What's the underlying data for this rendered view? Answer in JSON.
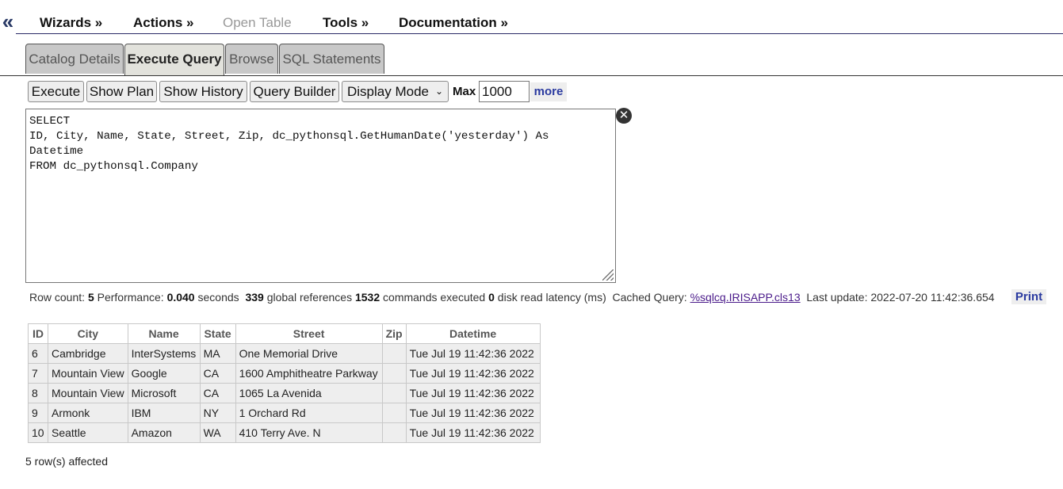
{
  "menu": {
    "collapse_glyph": "«",
    "items": [
      {
        "label": "Wizards »",
        "enabled": true
      },
      {
        "label": "Actions »",
        "enabled": true
      },
      {
        "label": "Open Table",
        "enabled": false
      },
      {
        "label": "Tools »",
        "enabled": true
      },
      {
        "label": "Documentation »",
        "enabled": true
      }
    ]
  },
  "tabs": [
    {
      "label": "Catalog Details",
      "active": false
    },
    {
      "label": "Execute Query",
      "active": true
    },
    {
      "label": "Browse",
      "active": false
    },
    {
      "label": "SQL Statements",
      "active": false
    }
  ],
  "toolbar": {
    "execute_label": "Execute",
    "show_plan_label": "Show Plan",
    "show_history_label": "Show History",
    "query_builder_label": "Query Builder",
    "display_mode_value": "Display Mode",
    "max_label": "Max",
    "max_value": "1000",
    "more_label": "more"
  },
  "query": {
    "text": "SELECT\nID, City, Name, State, Street, Zip, dc_pythonsql.GetHumanDate('yesterday') As\nDatetime\nFROM dc_pythonsql.Company"
  },
  "stats": {
    "row_count_label": "Row count:",
    "row_count": "5",
    "performance_label": "Performance:",
    "performance": "0.040",
    "seconds_label": "seconds",
    "global_refs": "339",
    "global_refs_label": "global references",
    "commands": "1532",
    "commands_label": "commands executed",
    "disk_latency": "0",
    "disk_latency_label": "disk read latency (ms)",
    "cached_query_label": "Cached Query:",
    "cached_query": "%sqlcq.IRISAPP.cls13",
    "last_update_label": "Last update:",
    "last_update": "2022-07-20 11:42:36.654",
    "print_label": "Print"
  },
  "results": {
    "columns": [
      "ID",
      "City",
      "Name",
      "State",
      "Street",
      "Zip",
      "Datetime"
    ],
    "rows": [
      [
        "6",
        "Cambridge",
        "InterSystems",
        "MA",
        "One Memorial Drive",
        "",
        "Tue Jul 19 11:42:36 2022"
      ],
      [
        "7",
        "Mountain View",
        "Google",
        "CA",
        "1600 Amphitheatre Parkway",
        "",
        "Tue Jul 19 11:42:36 2022"
      ],
      [
        "8",
        "Mountain View",
        "Microsoft",
        "CA",
        "1065 La Avenida",
        "",
        "Tue Jul 19 11:42:36 2022"
      ],
      [
        "9",
        "Armonk",
        "IBM",
        "NY",
        "1 Orchard Rd",
        "",
        "Tue Jul 19 11:42:36 2022"
      ],
      [
        "10",
        "Seattle",
        "Amazon",
        "WA",
        "410 Terry Ave. N",
        "",
        "Tue Jul 19 11:42:36 2022"
      ]
    ]
  },
  "footer": {
    "affected": "5 row(s) affected"
  }
}
